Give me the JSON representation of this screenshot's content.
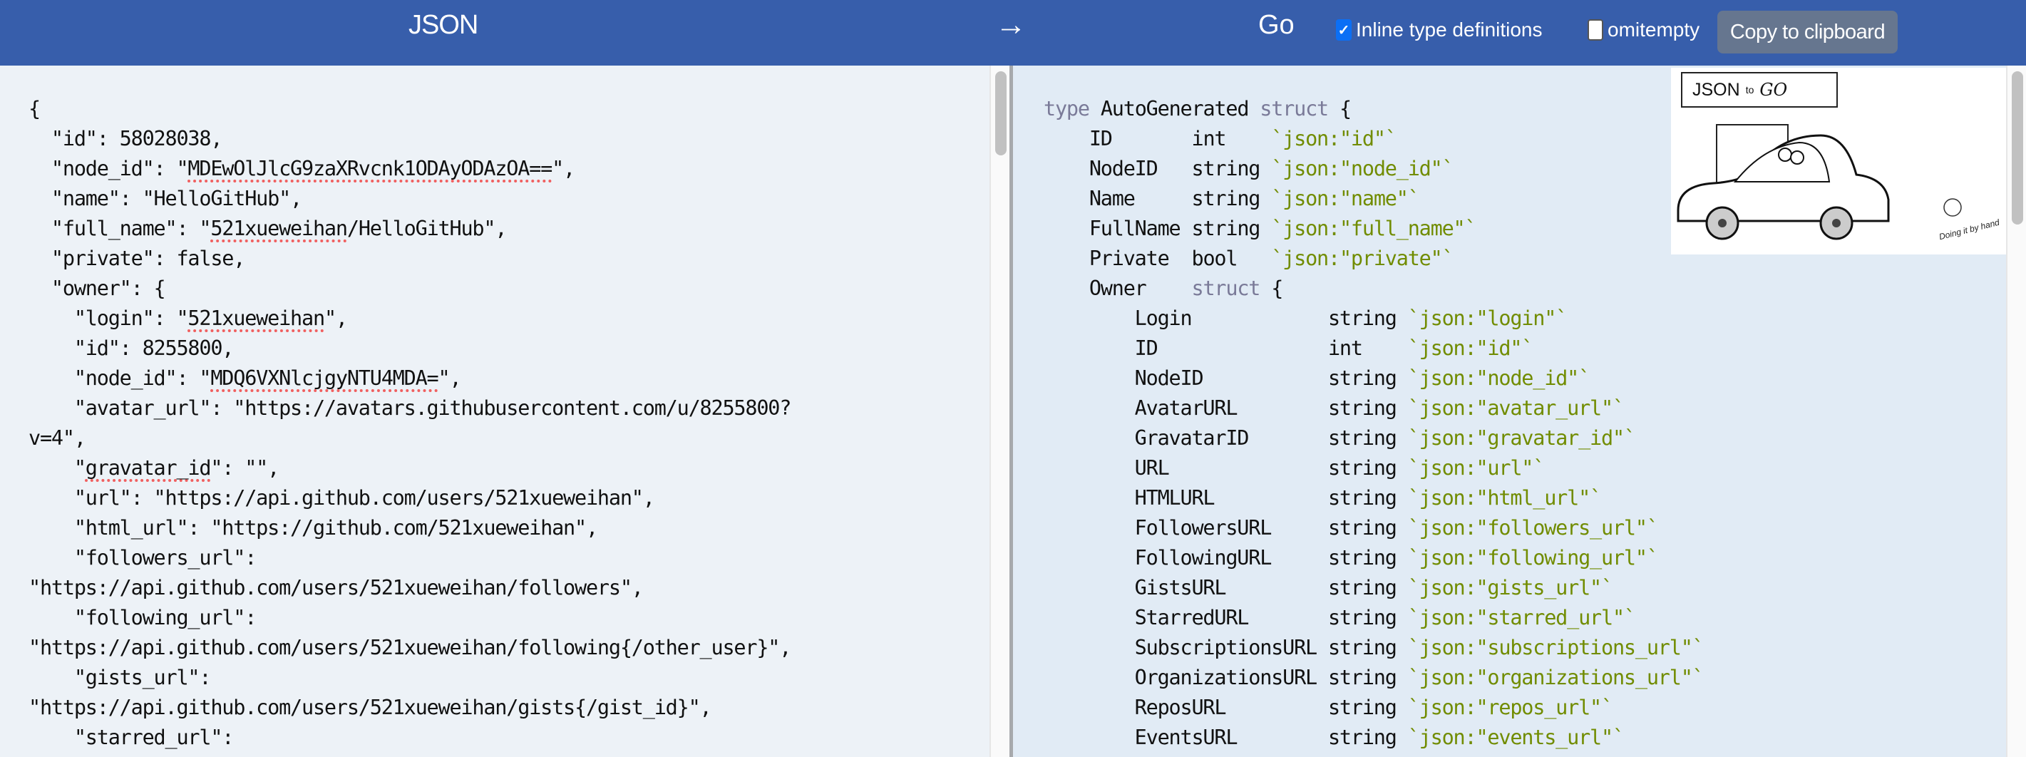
{
  "header": {
    "source_label": "JSON",
    "arrow": "→",
    "target_label": "Go",
    "inline_types": {
      "label": "Inline type definitions",
      "checked": true
    },
    "omitempty": {
      "label": "omitempty",
      "checked": false
    },
    "copy_button": "Copy to clipboard"
  },
  "json_input": {
    "lines": [
      "{",
      "  \"id\": 58028038,",
      "  \"node_id\": \"MDEwOlJlcG9zaXRvcnk1ODAyODAzOA==\",",
      "  \"name\": \"HelloGitHub\",",
      "  \"full_name\": \"521xueweihan/HelloGitHub\",",
      "  \"private\": false,",
      "  \"owner\": {",
      "    \"login\": \"521xueweihan\",",
      "    \"id\": 8255800,",
      "    \"node_id\": \"MDQ6VXNlcjgyNTU4MDA=\",",
      "    \"avatar_url\": \"https://avatars.githubusercontent.com/u/8255800?",
      "v=4\",",
      "    \"gravatar_id\": \"\",",
      "    \"url\": \"https://api.github.com/users/521xueweihan\",",
      "    \"html_url\": \"https://github.com/521xueweihan\",",
      "    \"followers_url\":",
      "\"https://api.github.com/users/521xueweihan/followers\",",
      "    \"following_url\":",
      "\"https://api.github.com/users/521xueweihan/following{/other_user}\",",
      "    \"gists_url\":",
      "\"https://api.github.com/users/521xueweihan/gists{/gist_id}\",",
      "    \"starred_url\":"
    ]
  },
  "go_output": {
    "type_name": "AutoGenerated",
    "keyword_type": "type",
    "keyword_struct": "struct",
    "fields": [
      {
        "name": "ID",
        "type": "int",
        "tag": "`json:\"id\"`"
      },
      {
        "name": "NodeID",
        "type": "string",
        "tag": "`json:\"node_id\"`"
      },
      {
        "name": "Name",
        "type": "string",
        "tag": "`json:\"name\"`"
      },
      {
        "name": "FullName",
        "type": "string",
        "tag": "`json:\"full_name\"`"
      },
      {
        "name": "Private",
        "type": "bool",
        "tag": "`json:\"private\"`"
      }
    ],
    "owner": {
      "name": "Owner",
      "fields": [
        {
          "name": "Login",
          "type": "string",
          "tag": "`json:\"login\"`"
        },
        {
          "name": "ID",
          "type": "int",
          "tag": "`json:\"id\"`"
        },
        {
          "name": "NodeID",
          "type": "string",
          "tag": "`json:\"node_id\"`"
        },
        {
          "name": "AvatarURL",
          "type": "string",
          "tag": "`json:\"avatar_url\"`"
        },
        {
          "name": "GravatarID",
          "type": "string",
          "tag": "`json:\"gravatar_id\"`"
        },
        {
          "name": "URL",
          "type": "string",
          "tag": "`json:\"url\"`"
        },
        {
          "name": "HTMLURL",
          "type": "string",
          "tag": "`json:\"html_url\"`"
        },
        {
          "name": "FollowersURL",
          "type": "string",
          "tag": "`json:\"followers_url\"`"
        },
        {
          "name": "FollowingURL",
          "type": "string",
          "tag": "`json:\"following_url\"`"
        },
        {
          "name": "GistsURL",
          "type": "string",
          "tag": "`json:\"gists_url\"`"
        },
        {
          "name": "StarredURL",
          "type": "string",
          "tag": "`json:\"starred_url\"`"
        },
        {
          "name": "SubscriptionsURL",
          "type": "string",
          "tag": "`json:\"subscriptions_url\"`"
        },
        {
          "name": "OrganizationsURL",
          "type": "string",
          "tag": "`json:\"organizations_url\"`"
        },
        {
          "name": "ReposURL",
          "type": "string",
          "tag": "`json:\"repos_url\"`"
        },
        {
          "name": "EventsURL",
          "type": "string",
          "tag": "`json:\"events_url\"`"
        }
      ]
    }
  },
  "illustration": {
    "title_json": "JSON",
    "title_to": "to",
    "title_go": "GO",
    "note": "Doing it by hand"
  },
  "colors": {
    "header_bg": "#375eab",
    "keyword": "#7a7a98",
    "tag": "#718c00",
    "checkbox_on": "#0b6ff5",
    "copy_button_bg": "#66768f"
  }
}
